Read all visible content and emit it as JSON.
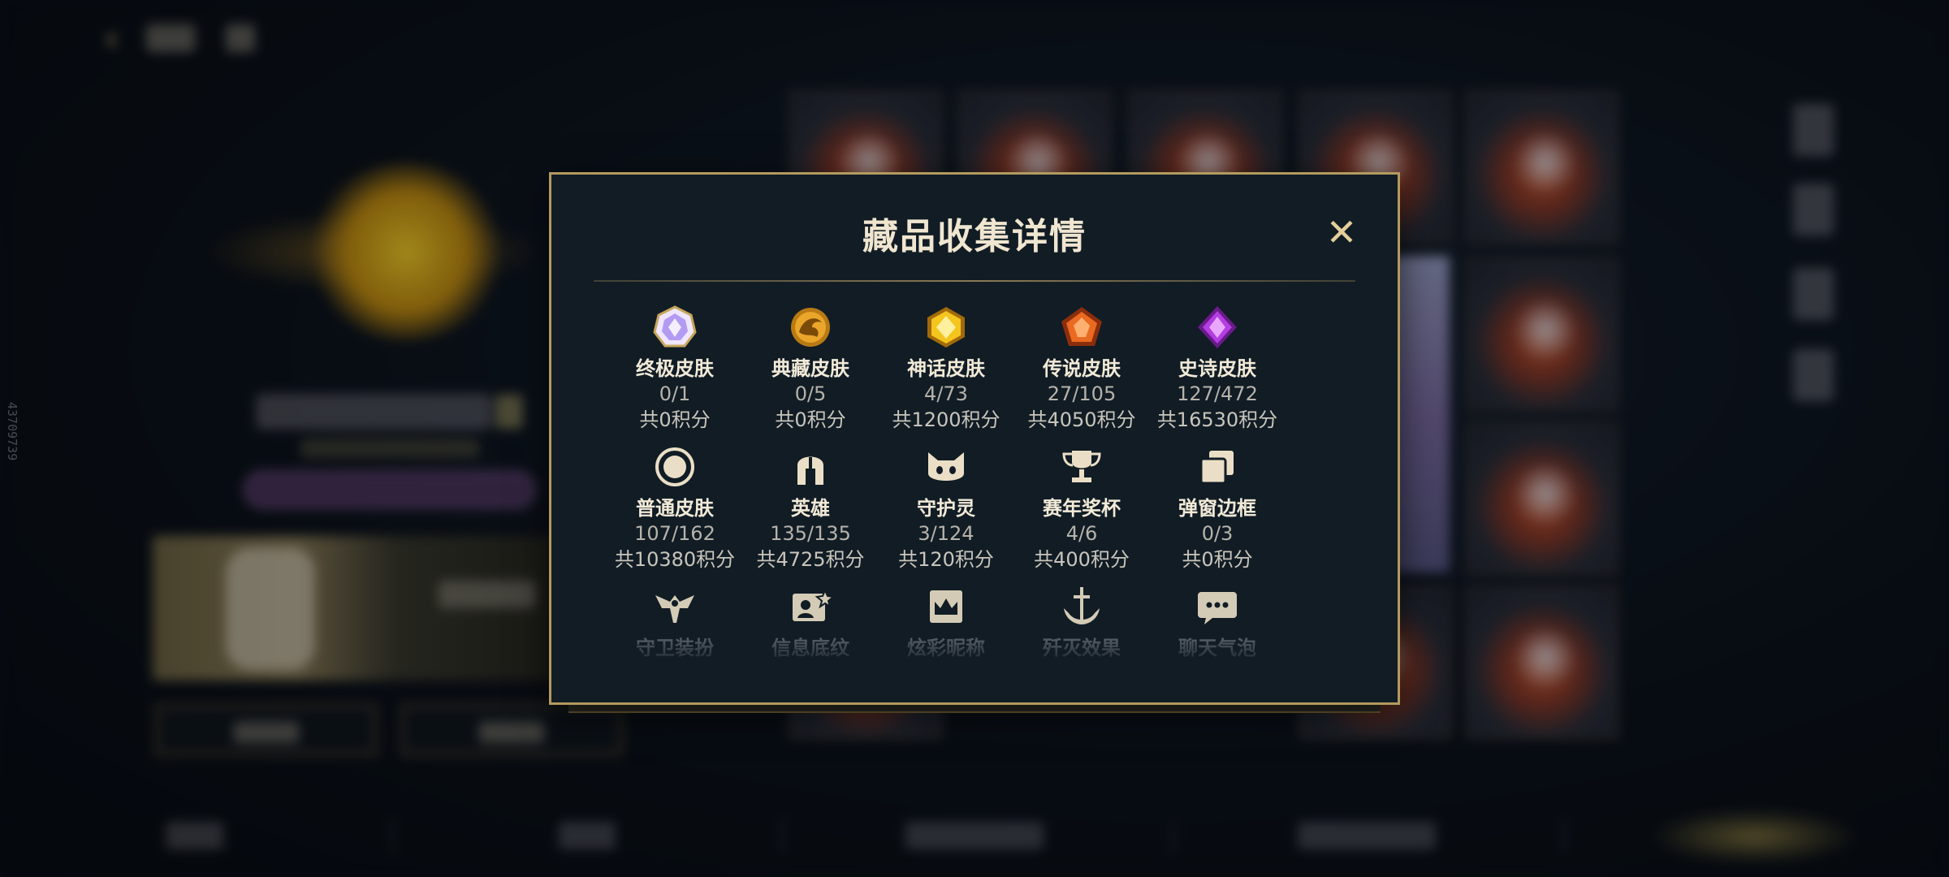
{
  "modal": {
    "title": "藏品收集详情",
    "close_label": "✕"
  },
  "categories": [
    {
      "name": "终极皮肤",
      "count": "0/1",
      "points": "共0积分",
      "icon": "ultimate-gem-icon",
      "color": "#b9a6f0"
    },
    {
      "name": "典藏皮肤",
      "count": "0/5",
      "points": "共0积分",
      "icon": "collector-dragon-icon",
      "color": "#e2a426"
    },
    {
      "name": "神话皮肤",
      "count": "4/73",
      "points": "共1200积分",
      "icon": "mythic-gem-icon",
      "color": "#f0c21c"
    },
    {
      "name": "传说皮肤",
      "count": "27/105",
      "points": "共4050积分",
      "icon": "legend-gem-icon",
      "color": "#e8621f"
    },
    {
      "name": "史诗皮肤",
      "count": "127/472",
      "points": "共16530积分",
      "icon": "epic-gem-icon",
      "color": "#b23ee0"
    },
    {
      "name": "普通皮肤",
      "count": "107/162",
      "points": "共10380积分",
      "icon": "ring-icon",
      "color": "#e8dcc0"
    },
    {
      "name": "英雄",
      "count": "135/135",
      "points": "共4725积分",
      "icon": "helmet-icon",
      "color": "#e8dcc0"
    },
    {
      "name": "守护灵",
      "count": "3/124",
      "points": "共120积分",
      "icon": "pet-face-icon",
      "color": "#e8dcc0"
    },
    {
      "name": "赛年奖杯",
      "count": "4/6",
      "points": "共400积分",
      "icon": "trophy-icon",
      "color": "#e8dcc0"
    },
    {
      "name": "弹窗边框",
      "count": "0/3",
      "points": "共0积分",
      "icon": "frame-stack-icon",
      "color": "#e8dcc0"
    },
    {
      "name": "守卫装扮",
      "icon": "ward-icon",
      "color": "#e8dcc0"
    },
    {
      "name": "信息底纹",
      "icon": "card-pattern-icon",
      "color": "#e8dcc0"
    },
    {
      "name": "炫彩昵称",
      "icon": "crown-card-icon",
      "color": "#e8dcc0"
    },
    {
      "name": "歼灭效果",
      "icon": "anchor-icon",
      "color": "#e8dcc0"
    },
    {
      "name": "聊天气泡",
      "icon": "chat-bubble-icon",
      "color": "#e8dcc0"
    }
  ],
  "side_id": "43709739",
  "colors": {
    "modal_bg": "#111c25",
    "modal_border": "#b39a5f",
    "title": "#f0e6d0"
  }
}
